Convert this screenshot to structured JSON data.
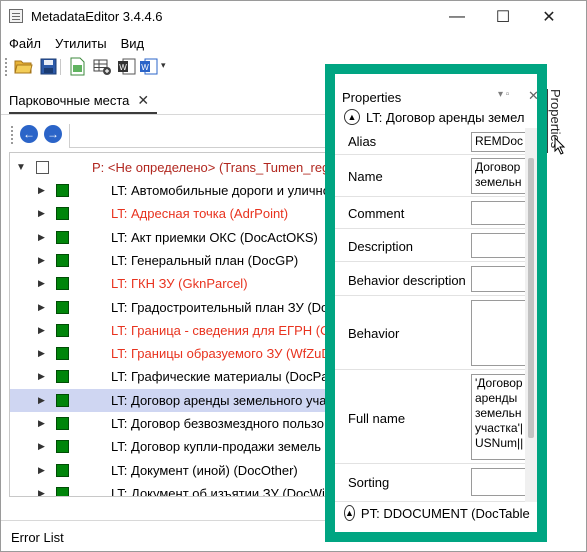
{
  "window": {
    "title": "MetadataEditor 3.4.4.6",
    "minimize": "—",
    "maximize": "☐",
    "close": "✕"
  },
  "menu": [
    "Файл",
    "Утилиты",
    "Вид"
  ],
  "tab": {
    "label": "Парковочные места",
    "close": "✕"
  },
  "nav": {
    "back": "←",
    "forward": "→"
  },
  "tree": {
    "root": "P: <Не определено> (Trans_Tumen_regio",
    "items": [
      {
        "label": "LT: Автомобильные дороги и улично",
        "color": "#000000"
      },
      {
        "label": "LT: Адресная точка (AdrPoint)",
        "color": "#e8331f"
      },
      {
        "label": "LT: Акт приемки ОКС (DocActOKS)",
        "color": "#000000"
      },
      {
        "label": "LT: Генеральный план (DocGP)",
        "color": "#000000"
      },
      {
        "label": "LT: ГКН ЗУ (GknParcel)",
        "color": "#e8331f"
      },
      {
        "label": "LT: Градостроительный план ЗУ (Doc",
        "color": "#000000"
      },
      {
        "label": "LT: Граница - сведения для ЕГРН (OA",
        "color": "#e8331f"
      },
      {
        "label": "LT: Границы образуемого ЗУ (WfZuD",
        "color": "#e8331f"
      },
      {
        "label": "LT: Графические материалы (DocPart",
        "color": "#000000"
      },
      {
        "label": "LT: Договор аренды земельного уча",
        "color": "#000000",
        "selected": true
      },
      {
        "label": "LT: Договор безвозмездного пользо",
        "color": "#000000"
      },
      {
        "label": "LT: Договор купли-продажи земель",
        "color": "#000000"
      },
      {
        "label": "LT: Документ (иной) (DocOther)",
        "color": "#000000"
      },
      {
        "label": "LT: Документ об изъятии ЗУ (DocWit",
        "color": "#000000"
      }
    ]
  },
  "error_list": "Error List",
  "side_tab": "Properties",
  "properties": {
    "title": "Properties",
    "header_controls": "▾ ▫",
    "close": "✕",
    "section_1": "LT: Договор аренды земел",
    "section_2": "PT: DDOCUMENT (DocTable",
    "rows": [
      {
        "label": "Alias",
        "value": "REMDoc"
      },
      {
        "label": "Name",
        "value": "Договор\nземельн"
      },
      {
        "label": "Comment",
        "value": ""
      },
      {
        "label": "Description",
        "value": ""
      },
      {
        "label": "Behavior description",
        "value": ""
      },
      {
        "label": "Behavior",
        "value": ""
      },
      {
        "label": "Full name",
        "value": "'Договор\nаренды\nземельн\nучастка'|\nUSNum||"
      },
      {
        "label": "Sorting",
        "value": ""
      }
    ]
  },
  "colors": {
    "accent_frame": "#00a582",
    "selected_row": "#cfd6f2",
    "status_square": "#00850a",
    "error_text": "#e8331f"
  }
}
